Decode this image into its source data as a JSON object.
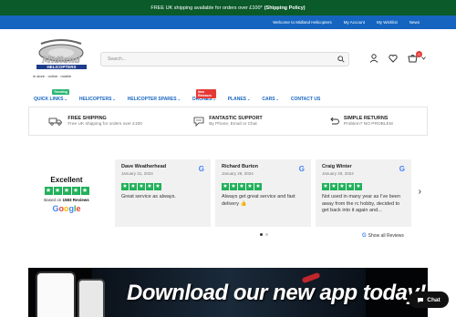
{
  "announcement": {
    "text": "FREE UK shipping available for orders over £100*",
    "link": "(Shipping Policy)"
  },
  "topnav": [
    "Welcome to Midland Helicopters",
    "My Account",
    "My Wishlist",
    "News"
  ],
  "logo": {
    "wordmark": "Midland",
    "sub": "HELICOPTERS",
    "tagline": "in store . online . mobile"
  },
  "search": {
    "placeholder": "Search..."
  },
  "cart_count": "0",
  "categories": [
    {
      "label": "QUICK LINKS",
      "tag": "Trending",
      "tag_color": "#2bb673"
    },
    {
      "label": "HELICOPTERS"
    },
    {
      "label": "HELICOPTER SPARES"
    },
    {
      "label": "DRONES",
      "tag": "New Releases",
      "tag_color": "#e53935"
    },
    {
      "label": "PLANES"
    },
    {
      "label": "CARS"
    },
    {
      "label": "CONTACT US",
      "nochev": true
    }
  ],
  "features": [
    {
      "title": "FREE SHIPPING",
      "sub": "Free UK shipping for orders over £100"
    },
    {
      "title": "FANTASTIC SUPPORT",
      "sub": "By Phone, Email or Chat"
    },
    {
      "title": "SIMPLE RETURNS",
      "sub": "Problem? NO PROBLEM"
    }
  ],
  "reviews_summary": {
    "rating": "Excellent",
    "based_prefix": "Based on",
    "count": "1583 Reviews",
    "brand": "Google"
  },
  "reviews": [
    {
      "name": "Dave Weatherhead",
      "date": "January 31, 2024",
      "text": "Great service as always."
    },
    {
      "name": "Richard Burton",
      "date": "January 29, 2024",
      "text": "Always get great service and fast delivery 👍"
    },
    {
      "name": "Craig Winter",
      "date": "January 29, 2024",
      "text": "Not used in many year as I've been away from the rc hobby, decided to get back into it again and..."
    }
  ],
  "show_all": "Show all Reviews",
  "banner": {
    "headline": "Download our new app today!"
  },
  "chat": {
    "label": "Chat"
  },
  "colors": {
    "announce_bg": "#0b5a2a",
    "nav_blue": "#1565c0",
    "star_green": "#20b15a"
  }
}
